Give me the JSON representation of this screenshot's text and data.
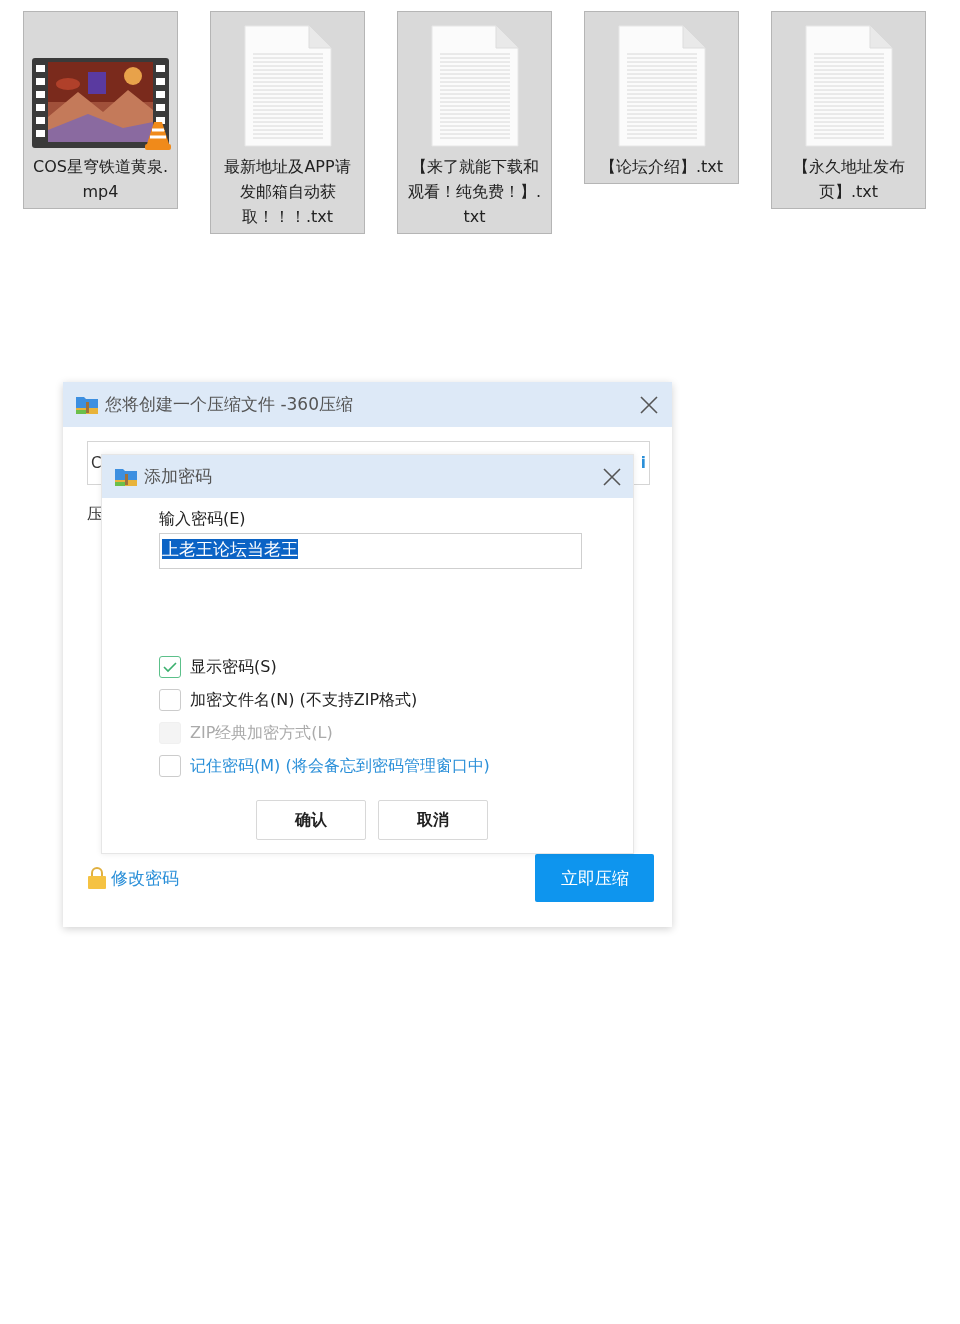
{
  "files": [
    {
      "name": "COS星穹铁道黄泉.mp4",
      "kind": "video"
    },
    {
      "name": "最新地址及APP请发邮箱自动获取！！！.txt",
      "kind": "document"
    },
    {
      "name": "【来了就能下载和观看！纯免费！】.txt",
      "kind": "document"
    },
    {
      "name": "【论坛介绍】.txt",
      "kind": "document"
    },
    {
      "name": "【永久地址发布页】.txt",
      "kind": "document"
    }
  ],
  "compress_window": {
    "title": "您将创建一个压缩文件 -360压缩",
    "path_field": {
      "start": "C",
      "end": "i"
    },
    "label": "压",
    "change_password_link": "修改密码",
    "compress_button": "立即压缩"
  },
  "password_dialog": {
    "title": "添加密码",
    "password_label": "输入密码(E)",
    "password": {
      "value": "上老王论坛当老王",
      "text_selected": true
    },
    "options": [
      {
        "label": "显示密码(S)",
        "checked": true,
        "disabled": false,
        "kind": "plain"
      },
      {
        "label": "加密文件名(N) (不支持ZIP格式)",
        "checked": false,
        "disabled": false,
        "kind": "plain"
      },
      {
        "label": "ZIP经典加密方式(L)",
        "checked": false,
        "disabled": true,
        "kind": "plain"
      },
      {
        "label": "记住密码(M) (将会备忘到密码管理窗口中)",
        "checked": false,
        "disabled": false,
        "kind": "link"
      }
    ],
    "buttons": [
      "确认",
      "取消"
    ]
  }
}
